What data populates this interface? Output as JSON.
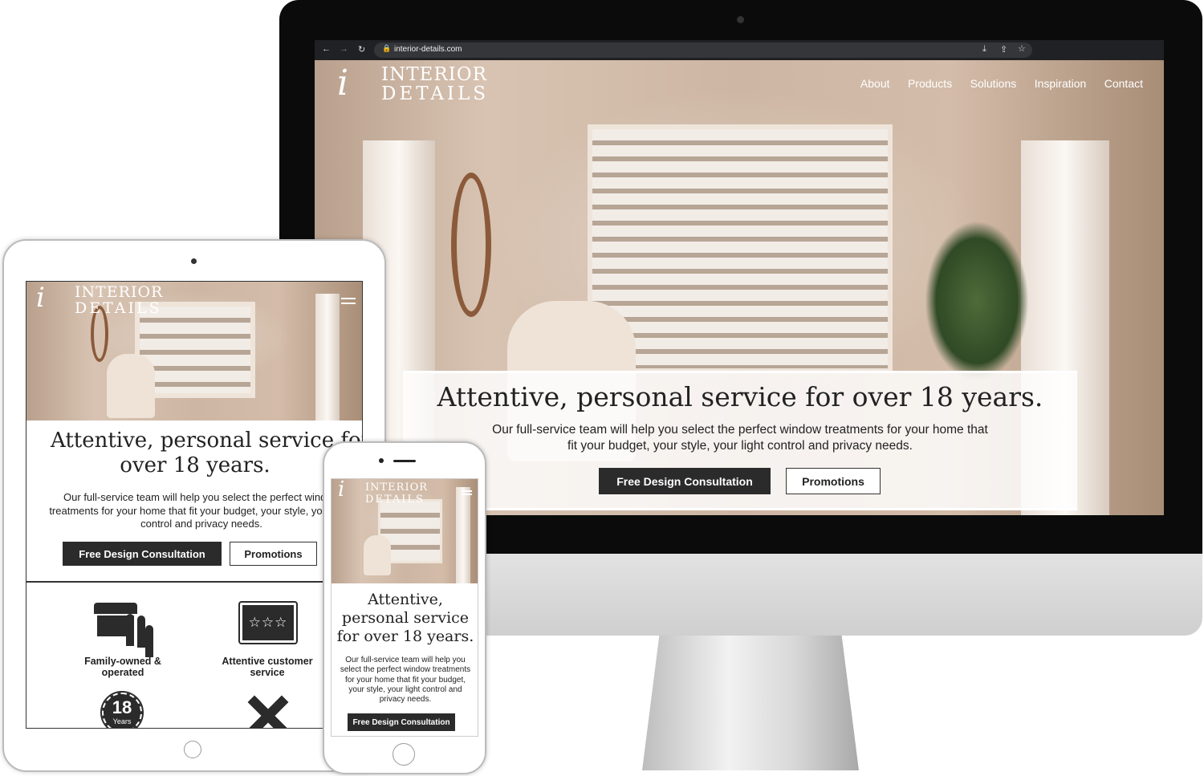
{
  "browser": {
    "url": "interior-details.com"
  },
  "site": {
    "logo_line1": "INTERIOR",
    "logo_line2": "DETAILS",
    "nav": [
      "About",
      "Products",
      "Solutions",
      "Inspiration",
      "Contact"
    ],
    "headline": "Attentive, personal service for over 18 years.",
    "tablet_headline_1": "Attentive, personal service for",
    "tablet_headline_2": "over 18 years.",
    "phone_headline": "Attentive, personal service for over 18 years.",
    "body": "Our full-service team will help you select the perfect window treatments for your home that fit your budget, your style, your light control and privacy needs.",
    "cta_primary": "Free Design Consultation",
    "cta_secondary": "Promotions",
    "features": [
      {
        "label": "Family-owned & operated",
        "icon": "family-store-icon"
      },
      {
        "label": "Attentive customer service",
        "icon": "star-rating-icon"
      },
      {
        "label": "",
        "icon": "18-years-badge-icon",
        "badge_number": "18",
        "badge_text": "Years"
      },
      {
        "label": "",
        "icon": "ruler-pencil-icon"
      }
    ]
  },
  "colors": {
    "dark": "#2b2b2b",
    "browser_bar": "#202124",
    "bezel": "#0b0b0b"
  }
}
